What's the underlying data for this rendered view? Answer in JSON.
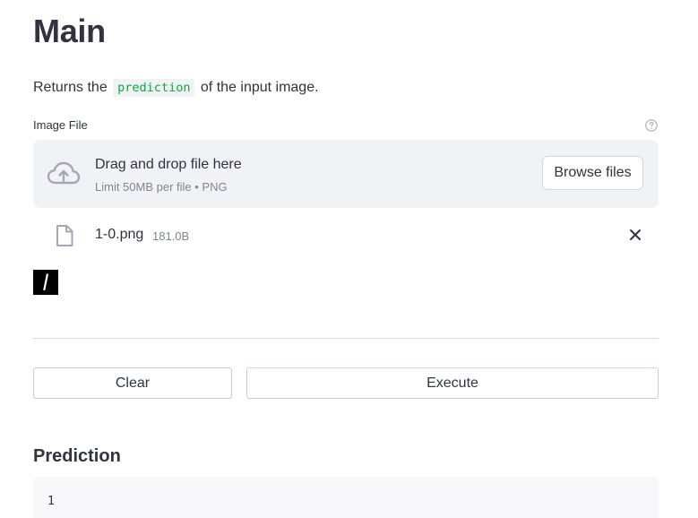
{
  "header": {
    "title": "Main"
  },
  "description": {
    "before": "Returns the",
    "code": "prediction",
    "after": "of the input image."
  },
  "uploader": {
    "label": "Image File",
    "help_icon": "question-circle-icon",
    "drop_title": "Drag and drop file here",
    "limit_text": "Limit 50MB per file • PNG",
    "browse_label": "Browse files",
    "upload_icon": "cloud-upload-icon",
    "file": {
      "name": "1-0.png",
      "size": "181.0B",
      "icon": "file-icon",
      "remove_icon": "close-icon"
    },
    "preview": {
      "glyph": "/"
    }
  },
  "actions": {
    "clear_label": "Clear",
    "execute_label": "Execute"
  },
  "result": {
    "title": "Prediction",
    "value": "1"
  },
  "colors": {
    "text": "#31333f",
    "code_accent": "#09ab3b",
    "muted": "#808495",
    "dropzone_bg": "#f0f2f6"
  }
}
